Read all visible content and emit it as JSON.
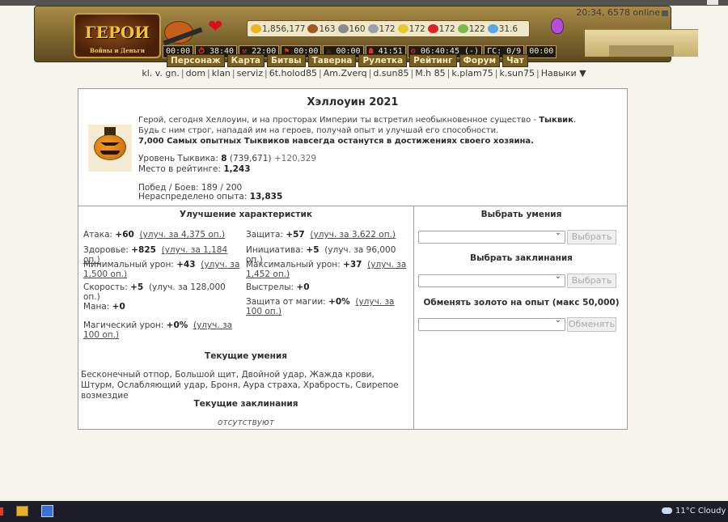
{
  "header": {
    "logo_text": "ГЕРОИ",
    "logo_subtext": "Войны и Деньги",
    "clock": "20:34, 6578 online",
    "resources": [
      {
        "name": "gold",
        "value": "1,856,177",
        "color": "#e8b620"
      },
      {
        "name": "wood",
        "value": "163",
        "color": "#9c5a24"
      },
      {
        "name": "ore",
        "value": "160",
        "color": "#8a8a8a"
      },
      {
        "name": "mercury",
        "value": "172",
        "color": "#9aa0aa"
      },
      {
        "name": "sulfur",
        "value": "172",
        "color": "#e6c830"
      },
      {
        "name": "crystal",
        "value": "172",
        "color": "#d8242a"
      },
      {
        "name": "gems",
        "value": "122",
        "color": "#7ab84a"
      },
      {
        "name": "diamonds",
        "value": "31.6",
        "color": "#58a8e8"
      }
    ],
    "timers": [
      {
        "icon": "",
        "value": "00:00"
      },
      {
        "icon": "⏱",
        "value": "38:40"
      },
      {
        "icon": "⚒",
        "value": "22:00"
      },
      {
        "icon": "⚑",
        "value": "00:00"
      },
      {
        "icon": "⚔",
        "value": "00:00"
      },
      {
        "icon": "☗",
        "value": "41:51"
      },
      {
        "icon": "⚙",
        "value": "06:40:45 (-)"
      },
      {
        "icon": "",
        "value": "ГС: 0/9"
      },
      {
        "icon": "",
        "value": "00:00"
      }
    ]
  },
  "nav": {
    "items": [
      "Персонаж",
      "Карта",
      "Битвы",
      "Таверна",
      "Рулетка",
      "Рейтинг",
      "Форум",
      "Чат"
    ]
  },
  "links": [
    "kl. v. gn.",
    "dom",
    "klan",
    "serviz",
    "6t.holod85",
    "Am.Zverq",
    "d.sun85",
    "M.h 85",
    "k.plam75",
    "k.sun75",
    "Навыки ▼"
  ],
  "event": {
    "title": "Хэллоуин 2021",
    "intro_line1_a": "Герой, сегодня Хеллоуин, и на просторах Империи ты встретил необыкновенное существо - ",
    "intro_line1_b": "Тыквик",
    "intro_line1_c": ".",
    "intro_line2": "Будь с ним строг, нападай им на героев, получай опыт и улучшай его способности.",
    "intro_line3": "7,000 Самых опытных Тыквиков навсегда останутся в достижениях своего хозяина.",
    "level_label": "Уровень Тыквика: ",
    "level_value": "8",
    "level_exp": "(739,671)",
    "level_plus": "+120,329",
    "rank_label": "Место в рейтинге: ",
    "rank_value": "1,243",
    "wins_label": "Побед / Боев: 189 / 200",
    "unspent_label": "Нераспределено опыта: ",
    "unspent_value": "13,835"
  },
  "upgrades": {
    "title": "Улучшение характеристик",
    "left": [
      {
        "label": "Атака: ",
        "value": "+60",
        "link": "(улуч. за 4,375 оп.)",
        "plain": ""
      },
      {
        "label": "Здоровье: ",
        "value": "+825",
        "link": "(улуч. за 1,184 оп.)",
        "plain": ""
      },
      {
        "label": "Минимальный урон: ",
        "value": "+43",
        "link": "(улуч. за 1,500 оп.)",
        "plain": ""
      },
      {
        "label": "Скорость: ",
        "value": "+5",
        "link": "",
        "plain": "(улуч. за 128,000 оп.)"
      },
      {
        "label": "Мана: ",
        "value": "+0",
        "link": "",
        "plain": ""
      },
      {
        "label": "Магический урон: ",
        "value": "+0%",
        "link": "(улуч. за 100 оп.)",
        "plain": ""
      }
    ],
    "right": [
      {
        "label": "Защита: ",
        "value": "+57",
        "link": "(улуч. за 3,622 оп.)",
        "plain": ""
      },
      {
        "label": "Инициатива: ",
        "value": "+5",
        "link": "",
        "plain": "(улуч. за 96,000 оп.)"
      },
      {
        "label": "Максимальный урон: ",
        "value": "+37",
        "link": "(улуч. за 1,452 оп.)",
        "plain": ""
      },
      {
        "label": "Выстрелы: ",
        "value": "+0",
        "link": "",
        "plain": ""
      },
      {
        "label": "Защита от магии: ",
        "value": "+0%",
        "link": "(улуч. за 100 оп.)",
        "plain": ""
      }
    ]
  },
  "current_skills": {
    "title": "Текущие умения",
    "text": "Бесконечный отпор, Большой щит, Двойной удар, Жажда крови, Штурм, Ослабляющий удар, Броня, Аура страха, Храбрость, Свирепое возмездие"
  },
  "current_spells": {
    "title": "Текущие заклинания",
    "text": "отсутствуют"
  },
  "right_panel": {
    "skills_title": "Выбрать умения",
    "skills_button": "Выбрать",
    "spells_title": "Выбрать заклинания",
    "spells_button": "Выбрать",
    "exchange_title": "Обменять золото на опыт (макс 50,000)",
    "exchange_button": "Обменять"
  },
  "taskbar": {
    "weather": "11°C  Cloudy"
  }
}
